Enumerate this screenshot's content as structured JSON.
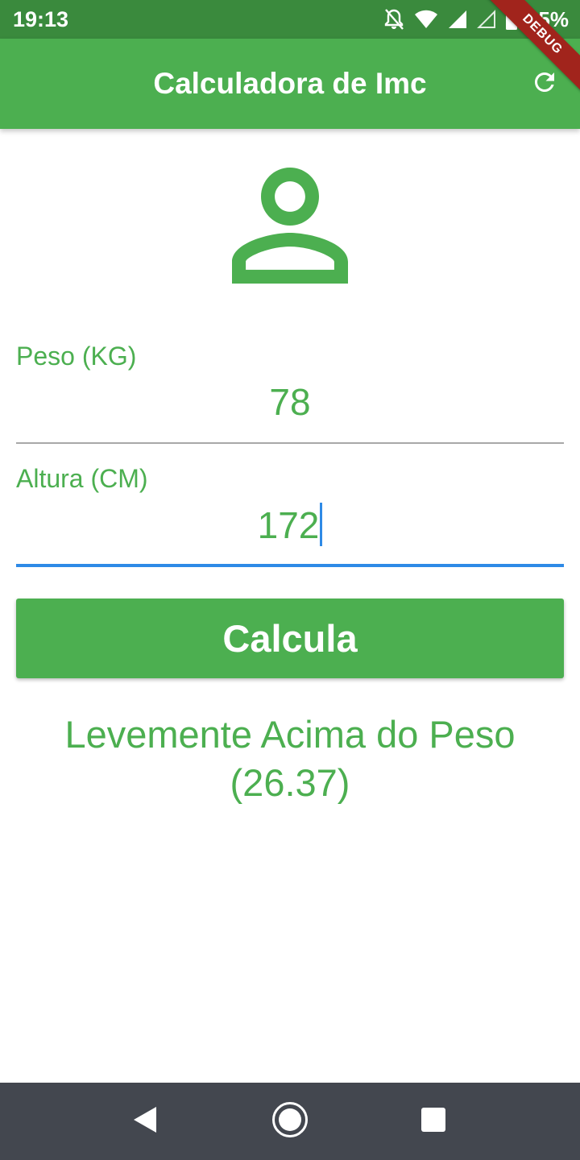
{
  "status_bar": {
    "time": "19:13",
    "battery": "95%",
    "icons": [
      "notifications-off-icon",
      "wifi-icon",
      "signal-icon",
      "signal-empty-icon",
      "battery-icon"
    ]
  },
  "app_bar": {
    "title": "Calculadora de Imc",
    "refresh_icon": "refresh-icon",
    "color": "#4caf50"
  },
  "debug_banner": "DEBUG",
  "avatar_icon": "person-outline-icon",
  "form": {
    "peso": {
      "label": "Peso (KG)",
      "value": "78"
    },
    "altura": {
      "label": "Altura (CM)",
      "value": "172"
    }
  },
  "button": {
    "label": "Calcula"
  },
  "result": {
    "line1": "Levemente Acima do Peso",
    "line2": "(26.37)"
  },
  "nav_bar": {
    "icons": [
      "back-icon",
      "home-icon",
      "recents-icon"
    ]
  },
  "colors": {
    "accent": "#4caf50",
    "status_bar": "#3a8a3d",
    "focus": "#2e8ae6",
    "nav_bar": "#43474f"
  }
}
